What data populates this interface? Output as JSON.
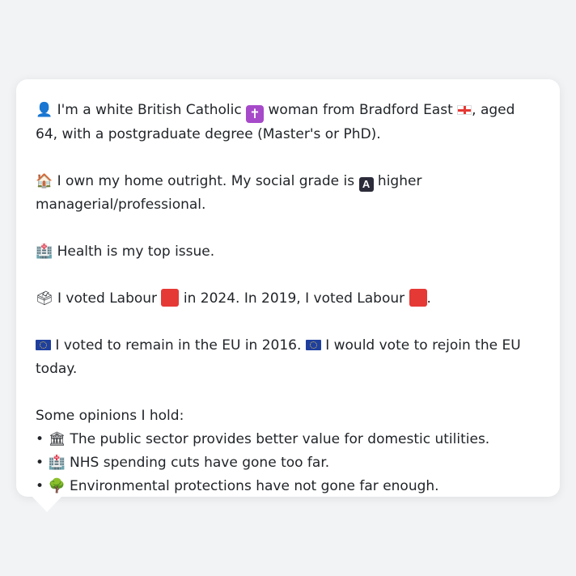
{
  "profile": {
    "line1": {
      "person_icon": "👤",
      "text_a": " I'm a white British Catholic ",
      "cross_icon": "✝",
      "text_b": " woman from Bradford East ",
      "text_c": ", aged 64, with a postgraduate degree (Master's or PhD)."
    },
    "line2": {
      "house_icon": "🏠",
      "text_a": " I own my home outright. My social grade is ",
      "grade_badge": "A",
      "text_b": " higher managerial/professional."
    },
    "line3": {
      "hospital_icon": "🏥",
      "text": " Health is my top issue."
    },
    "line4": {
      "ballot_icon": "🗳",
      "text_a": " I voted Labour ",
      "text_b": " in 2024. In 2019, I voted Labour ",
      "text_c": "."
    },
    "line5": {
      "text_a": " I voted to remain in the EU in 2016. ",
      "text_b": " I would vote to rejoin the EU today."
    },
    "opinions": {
      "heading": "Some opinions I hold:",
      "items": [
        {
          "bullet": "•",
          "icon": "🏛",
          "text": " The public sector provides better value for domestic utilities."
        },
        {
          "bullet": "•",
          "icon": "🏥",
          "text": " NHS spending cuts have gone too far."
        },
        {
          "bullet": "•",
          "icon": "🌳",
          "text": " Environmental protections have not gone far enough."
        }
      ]
    }
  },
  "colors": {
    "background": "#f1f3f5",
    "card": "#ffffff",
    "text": "#212529",
    "labour_red": "#e53935",
    "eu_blue": "#1e3f9e"
  }
}
